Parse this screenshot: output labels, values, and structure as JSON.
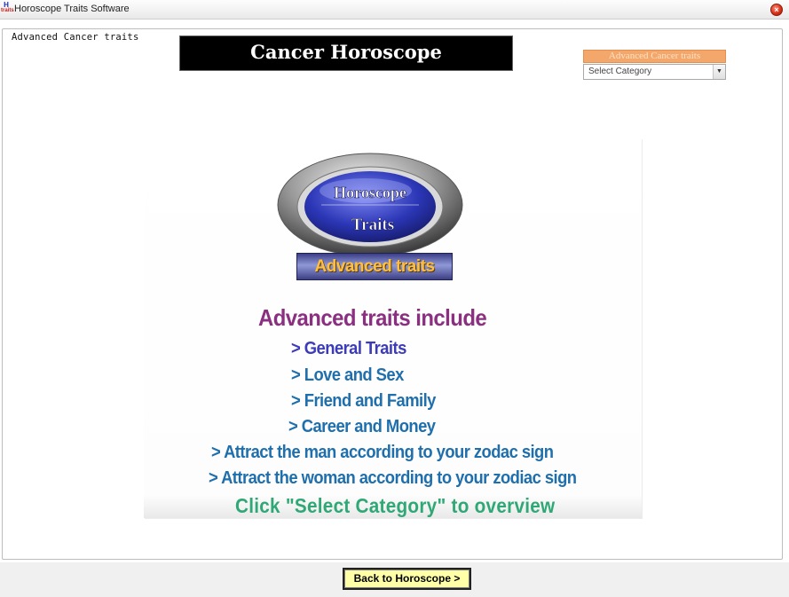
{
  "window": {
    "title": "Horoscope Traits Software",
    "icon_letters": {
      "top": "H",
      "bottom": "traits"
    },
    "close_glyph": "×"
  },
  "group": {
    "legend": "Advanced Cancer  traits"
  },
  "header": {
    "title": "Cancer  Horoscope"
  },
  "category": {
    "header": "Advanced Cancer  traits",
    "selected": "Select Category",
    "arrow": "▼"
  },
  "banner": {
    "logo_top": "Horoscope",
    "logo_bottom": "Traits",
    "badge": "Advanced  traits",
    "heading": "Advanced traits include",
    "traits": [
      "> General Traits",
      "> Love and Sex",
      "> Friend and Family",
      "> Career and Money",
      "> Attract the man according to your zodac sign",
      "> Attract the woman according to your zodiac sign"
    ],
    "instruction": "Click \"Select Category\" to overview"
  },
  "footer": {
    "back_label": "Back to Horoscope >"
  },
  "colors": {
    "heading_bg": "#000000",
    "category_header": "#f4a76b",
    "back_button_bg": "#ffffa8",
    "trait_blue": "#1f6fad",
    "include_purple": "#8b2f80",
    "instruction_green": "#2fa876"
  }
}
